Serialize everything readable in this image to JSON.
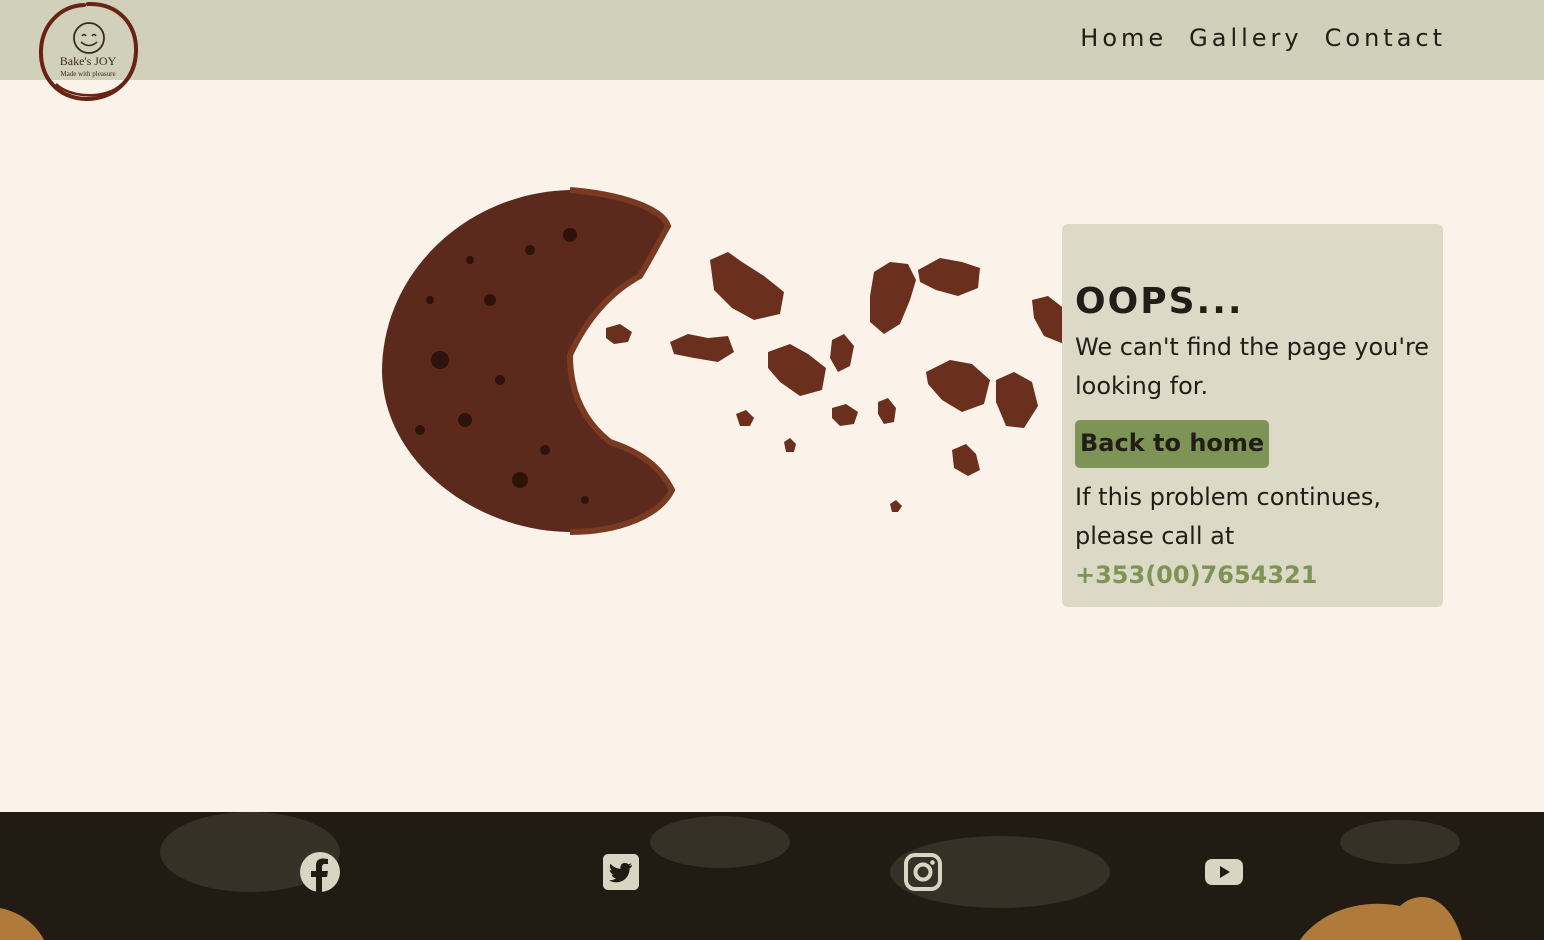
{
  "brand": {
    "name": "Bake's JOY",
    "tagline": "Made with pleasure",
    "colors": {
      "header_bg": "#d1d0ba",
      "page_bg": "#fbf3ea",
      "card_bg": "#dcd9c6",
      "accent": "#7e9456",
      "text": "#221d16",
      "logo_ring": "#6a2313",
      "footer_bg": "#211b14"
    }
  },
  "nav": {
    "items": [
      {
        "label": "Home"
      },
      {
        "label": "Gallery"
      },
      {
        "label": "Contact"
      }
    ]
  },
  "error": {
    "title": "OOPS...",
    "message": "We can't find the page you're looking for.",
    "button_label": "Back to home",
    "help_text": "If this problem continues, please call at",
    "phone": "+353(00)7654321"
  },
  "footer": {
    "social": [
      {
        "icon": "facebook-icon"
      },
      {
        "icon": "twitter-icon"
      },
      {
        "icon": "instagram-icon"
      },
      {
        "icon": "youtube-icon"
      }
    ]
  }
}
